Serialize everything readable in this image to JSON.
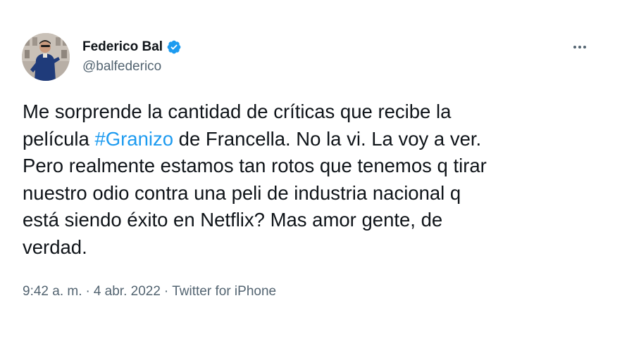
{
  "author": {
    "name": "Federico Bal",
    "handle": "@balfederico",
    "verified": true,
    "avatar_icon": "profile-photo"
  },
  "more_icon": "more-dots-icon",
  "tweet": {
    "lines": [
      {
        "before": "Me sorprende la cantidad de críticas que recibe la",
        "hashtag": "",
        "after": ""
      },
      {
        "before": "película ",
        "hashtag": "#Granizo",
        "after": " de Francella. No la vi. La voy a ver."
      },
      {
        "before": "Pero realmente estamos tan rotos que tenemos q tirar",
        "hashtag": "",
        "after": ""
      },
      {
        "before": "nuestro odio contra una peli de industria nacional q",
        "hashtag": "",
        "after": ""
      },
      {
        "before": "está siendo éxito en Netflix? Mas amor gente, de",
        "hashtag": "",
        "after": ""
      },
      {
        "before": "verdad.",
        "hashtag": "",
        "after": ""
      }
    ]
  },
  "meta": {
    "time": "9:42 a. m.",
    "separator": "·",
    "date": "4 abr. 2022",
    "source": "Twitter for iPhone"
  },
  "colors": {
    "link": "#1d9bf0",
    "secondary_text": "#536471",
    "primary_text": "#0f1419",
    "verified_badge": "#1d9bf0"
  }
}
